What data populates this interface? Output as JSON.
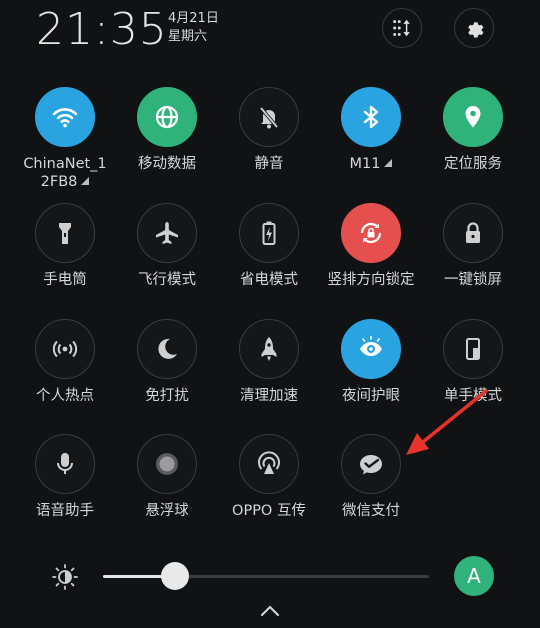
{
  "header": {
    "time": "21:35",
    "date_line1": "4月21日",
    "date_line2": "星期六",
    "sort_icon": "sort-icon",
    "settings_icon": "gear-icon"
  },
  "tiles": [
    {
      "label": "ChinaNet_1",
      "label2": "2FB8",
      "icon": "wifi-icon",
      "state": "on",
      "color": "#2aa4e0"
    },
    {
      "label": "移动数据",
      "icon": "globe-icon",
      "state": "on",
      "color": "#2fb37a"
    },
    {
      "label": "静音",
      "icon": "bell-off-icon",
      "state": "off"
    },
    {
      "label": "M11",
      "icon": "bluetooth-icon",
      "state": "on",
      "color": "#2aa4e0"
    },
    {
      "label": "定位服务",
      "icon": "location-icon",
      "state": "on",
      "color": "#2fb37a"
    },
    {
      "label": "手电筒",
      "icon": "flashlight-icon",
      "state": "off"
    },
    {
      "label": "飞行模式",
      "icon": "airplane-icon",
      "state": "off"
    },
    {
      "label": "省电模式",
      "icon": "battery-saver-icon",
      "state": "off"
    },
    {
      "label": "竖排方向锁定",
      "icon": "rotation-lock-icon",
      "state": "on",
      "color": "#e5504f"
    },
    {
      "label": "一键锁屏",
      "icon": "lock-icon",
      "state": "off"
    },
    {
      "label": "个人热点",
      "icon": "hotspot-icon",
      "state": "off"
    },
    {
      "label": "免打扰",
      "icon": "moon-icon",
      "state": "off"
    },
    {
      "label": "清理加速",
      "icon": "rocket-icon",
      "state": "off"
    },
    {
      "label": "夜间护眼",
      "icon": "eye-icon",
      "state": "on",
      "color": "#2aa4e0"
    },
    {
      "label": "单手模式",
      "icon": "one-hand-icon",
      "state": "off"
    },
    {
      "label": "语音助手",
      "icon": "microphone-icon",
      "state": "off"
    },
    {
      "label": "悬浮球",
      "icon": "floating-ball-icon",
      "state": "off"
    },
    {
      "label": "OPPO 互传",
      "icon": "share-icon",
      "state": "off"
    },
    {
      "label": "微信支付",
      "icon": "wechat-pay-icon",
      "state": "off"
    }
  ],
  "brightness": {
    "icon": "brightness-icon",
    "level": 0.22,
    "auto_label": "A"
  },
  "expand_icon": "chevron-up-icon",
  "annotation_color": "#e8332b"
}
